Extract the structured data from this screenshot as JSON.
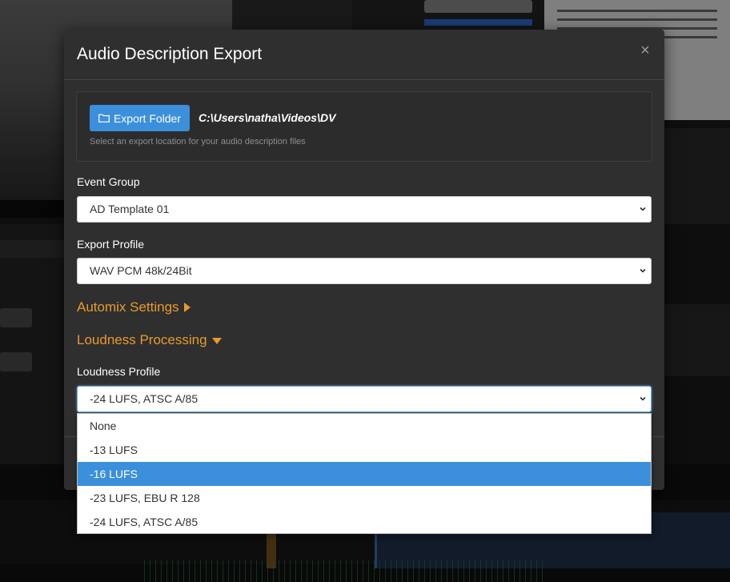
{
  "modal": {
    "title": "Audio Description Export",
    "close_glyph": "×",
    "close_icon": "close-icon"
  },
  "export": {
    "button_label": "Export Folder",
    "button_icon": "folder-icon",
    "path": "C:\\Users\\natha\\Videos\\DV",
    "help": "Select an export location for your audio description files"
  },
  "event_group": {
    "label": "Event Group",
    "value": "AD Template 01"
  },
  "export_profile": {
    "label": "Export Profile",
    "value": "WAV PCM 48k/24Bit"
  },
  "automix": {
    "label": "Automix Settings",
    "expanded": false
  },
  "loudness": {
    "label": "Loudness Processing",
    "expanded": true,
    "profile_label": "Loudness Profile",
    "profile_value": "-24 LUFS, ATSC A/85",
    "options": [
      "None",
      "-13 LUFS",
      "-16 LUFS",
      "-23 LUFS, EBU R 128",
      "-24 LUFS, ATSC A/85"
    ],
    "highlighted_option": "-16 LUFS"
  },
  "colors": {
    "modal_bg": "#2f2f2f",
    "accent_blue": "#3c8fdb",
    "section_orange": "#e89a2c",
    "text_white": "#ffffff"
  }
}
